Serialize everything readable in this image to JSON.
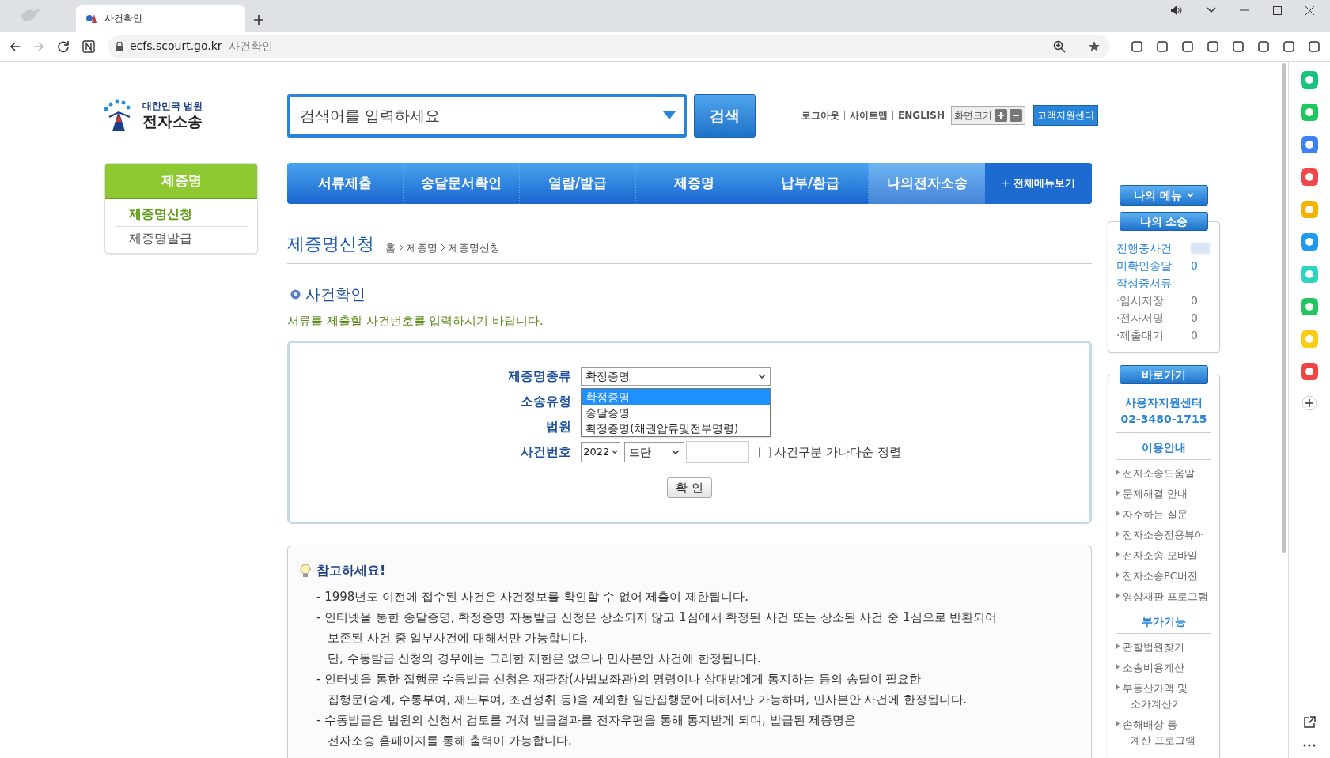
{
  "browser": {
    "tab_title": "사건확인",
    "url": "ecfs.scourt.go.kr",
    "url_title": "사건확인"
  },
  "header": {
    "logo_top": "대한민국 법원",
    "logo_bottom": "전자소송",
    "search_placeholder": "검색어를 입력하세요",
    "search_button": "검색",
    "links": [
      "로그아웃",
      "사이트맵",
      "ENGLISH"
    ],
    "font_size_label": "화면크기",
    "support_button": "고객지원센터"
  },
  "nav": {
    "items": [
      {
        "label": "서류제출",
        "selected": false
      },
      {
        "label": "송달문서확인",
        "selected": false
      },
      {
        "label": "열람/발급",
        "selected": false
      },
      {
        "label": "제증명",
        "selected": false
      },
      {
        "label": "납부/환급",
        "selected": false
      },
      {
        "label": "나의전자소송",
        "selected": true
      }
    ],
    "all_menu": "+ 전체메뉴보기"
  },
  "left_sidebar": {
    "title": "제증명",
    "items": [
      {
        "label": "제증명신청",
        "selected": true
      },
      {
        "label": "제증명발급",
        "selected": false
      }
    ]
  },
  "page": {
    "title": "제증명신청",
    "breadcrumb": [
      "홈",
      "제증명",
      "제증명신청"
    ],
    "section_title": "사건확인",
    "instruction": "서류를 제출할 사건번호를 입력하시기 바랍니다."
  },
  "form": {
    "labels": [
      "제증명종류",
      "소송유형",
      "법원",
      "사건번호"
    ],
    "cert_type": {
      "value": "확정증명",
      "options": [
        {
          "label": "확정증명",
          "selected": true
        },
        {
          "label": "송달증명",
          "selected": false
        },
        {
          "label": "확정증명(채권압류및전부명령)",
          "selected": false
        }
      ]
    },
    "year": "2022",
    "case_type": "드단",
    "sort_checkbox": {
      "label": "사건구분 가나다순 정렬",
      "checked": false
    },
    "confirm_button": "확 인"
  },
  "notes": {
    "title": "참고하세요!",
    "items": [
      [
        "- 1998년도 이전에 접수된 사건은 사건정보를 확인할 수 없어 제출이 제한됩니다."
      ],
      [
        "- 인터넷을 통한 송달증명, 확정증명 자동발급 신청은 상소되지 않고 1심에서 확정된 사건 또는 상소된 사건 중 1심으로 반환되어",
        "보존된 사건 중 일부사건에 대해서만 가능합니다.",
        "단, 수동발급 신청의 경우에는 그러한 제한은 없으나 민사본안 사건에 한정됩니다."
      ],
      [
        "- 인터넷을 통한 집행문 수동발급 신청은 재판장(사법보좌관)의 명령이나 상대방에게 통지하는 등의 송달이 필요한",
        "집행문(승계, 수통부여, 재도부여, 조건성취 등)을 제외한 일반집행문에 대해서만 가능하며, 민사본안 사건에 한정됩니다."
      ],
      [
        "- 수동발급은 법원의 신청서 검토를 거쳐 발급결과를 전자우편을 통해 통지받게 되며, 발급된 제증명은",
        "전자소송 홈페이지를 통해 출력이 가능합니다."
      ]
    ]
  },
  "right_sidebar": {
    "my_menu": "나의 메뉴",
    "my_cases": {
      "title": "나의 소송",
      "rows": [
        {
          "kind": "link",
          "label": "진행중사건",
          "blurred": true
        },
        {
          "kind": "link",
          "label": "미확인송달",
          "value": "0"
        },
        {
          "kind": "link",
          "label": "작성중서류"
        },
        {
          "kind": "sub",
          "label": "·임시저장",
          "value": "0"
        },
        {
          "kind": "sub",
          "label": "·전자서명",
          "value": "0"
        },
        {
          "kind": "sub",
          "label": "·제출대기",
          "value": "0"
        }
      ]
    },
    "shortcuts": {
      "title": "바로가기",
      "center_name": "사용자지원센터",
      "center_phone": "02-3480-1715",
      "sections": [
        {
          "title": "이용안내",
          "links": [
            [
              "전자소송도움말"
            ],
            [
              "문제해결 안내"
            ],
            [
              "자주하는 질문"
            ],
            [
              "전자소송전용뷰어"
            ],
            [
              "전자소송 모바일"
            ],
            [
              "전자소송PC버전"
            ],
            [
              "영상재판 프로그램"
            ]
          ]
        },
        {
          "title": "부가기능",
          "links": [
            [
              "관할법원찾기"
            ],
            [
              "소송비용계산"
            ],
            [
              "부동산가액 및",
              "소가계산기"
            ],
            [
              "손해배상 등",
              "계산 프로그램"
            ]
          ]
        }
      ]
    }
  }
}
